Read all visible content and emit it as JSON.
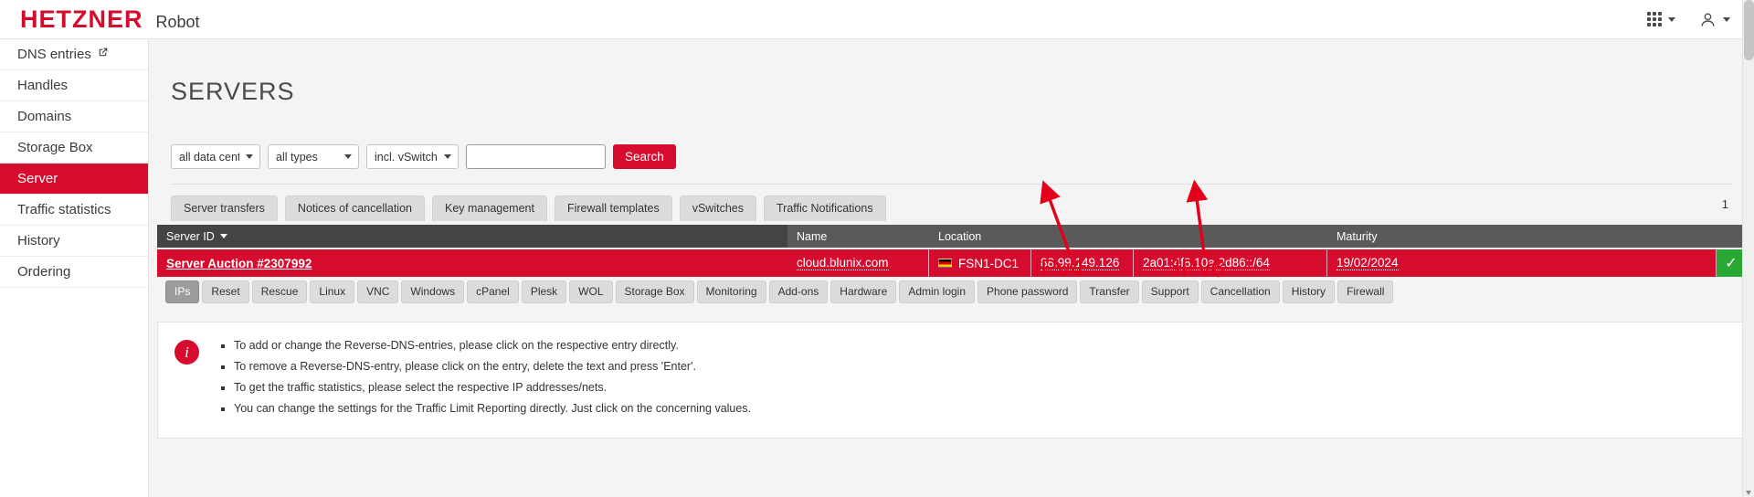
{
  "topbar": {
    "brand": "HETZNER",
    "app_title": "Robot",
    "apps_icon": "grid-icon",
    "user_icon": "user-icon"
  },
  "sidebar": {
    "items": [
      {
        "label": "DNS entries",
        "icon": "external-link-icon",
        "active": false
      },
      {
        "label": "Handles",
        "icon": "",
        "active": false
      },
      {
        "label": "Domains",
        "icon": "",
        "active": false
      },
      {
        "label": "Storage Box",
        "icon": "",
        "active": false
      },
      {
        "label": "Server",
        "icon": "",
        "active": true
      },
      {
        "label": "Traffic statistics",
        "icon": "",
        "active": false
      },
      {
        "label": "History",
        "icon": "",
        "active": false
      },
      {
        "label": "Ordering",
        "icon": "",
        "active": false
      }
    ]
  },
  "main": {
    "page_title": "SERVERS",
    "filters": {
      "datacentre": "all data centres",
      "types": "all types",
      "vswitch": "incl. vSwitch",
      "search_value": "",
      "search_placeholder": "",
      "search_button": "Search"
    },
    "tabs": [
      "Server transfers",
      "Notices of cancellation",
      "Key management",
      "Firewall templates",
      "vSwitches",
      "Traffic Notifications"
    ],
    "page_number": "1",
    "table": {
      "headers": {
        "server_id": "Server ID",
        "name": "Name",
        "location": "Location",
        "ipv4": "",
        "ipv6": "",
        "maturity": "Maturity"
      },
      "row": {
        "server_id": "Server Auction #2307992",
        "name": "cloud.blunix.com",
        "location": "FSN1-DC1",
        "location_flag": "germany-flag-icon",
        "ipv4": "88.99.149.126",
        "ipv6": "2a01:4f8:10a:2d86::/64",
        "maturity": "19/02/2024",
        "status_icon": "check-icon"
      }
    },
    "actions": [
      {
        "label": "IPs",
        "active": true
      },
      {
        "label": "Reset",
        "active": false
      },
      {
        "label": "Rescue",
        "active": false
      },
      {
        "label": "Linux",
        "active": false
      },
      {
        "label": "VNC",
        "active": false
      },
      {
        "label": "Windows",
        "active": false
      },
      {
        "label": "cPanel",
        "active": false
      },
      {
        "label": "Plesk",
        "active": false
      },
      {
        "label": "WOL",
        "active": false
      },
      {
        "label": "Storage Box",
        "active": false
      },
      {
        "label": "Monitoring",
        "active": false
      },
      {
        "label": "Add-ons",
        "active": false
      },
      {
        "label": "Hardware",
        "active": false
      },
      {
        "label": "Admin login",
        "active": false
      },
      {
        "label": "Phone password",
        "active": false
      },
      {
        "label": "Transfer",
        "active": false
      },
      {
        "label": "Support",
        "active": false
      },
      {
        "label": "Cancellation",
        "active": false
      },
      {
        "label": "History",
        "active": false
      },
      {
        "label": "Firewall",
        "active": false
      }
    ],
    "info": {
      "icon": "info-icon",
      "bullets": [
        "To add or change the Reverse-DNS-entries, please click on the respective entry directly.",
        "To remove a Reverse-DNS-entry, please click on the entry, delete the text and press 'Enter'.",
        "To get the traffic statistics, please select the respective IP addresses/nets.",
        "You can change the settings for the Traffic Limit Reporting directly. Just click on the concerning values."
      ]
    }
  },
  "annotations": {
    "ipv4_label": "IPv4",
    "ipv6_label": "IPv6",
    "color": "#e2001a"
  }
}
